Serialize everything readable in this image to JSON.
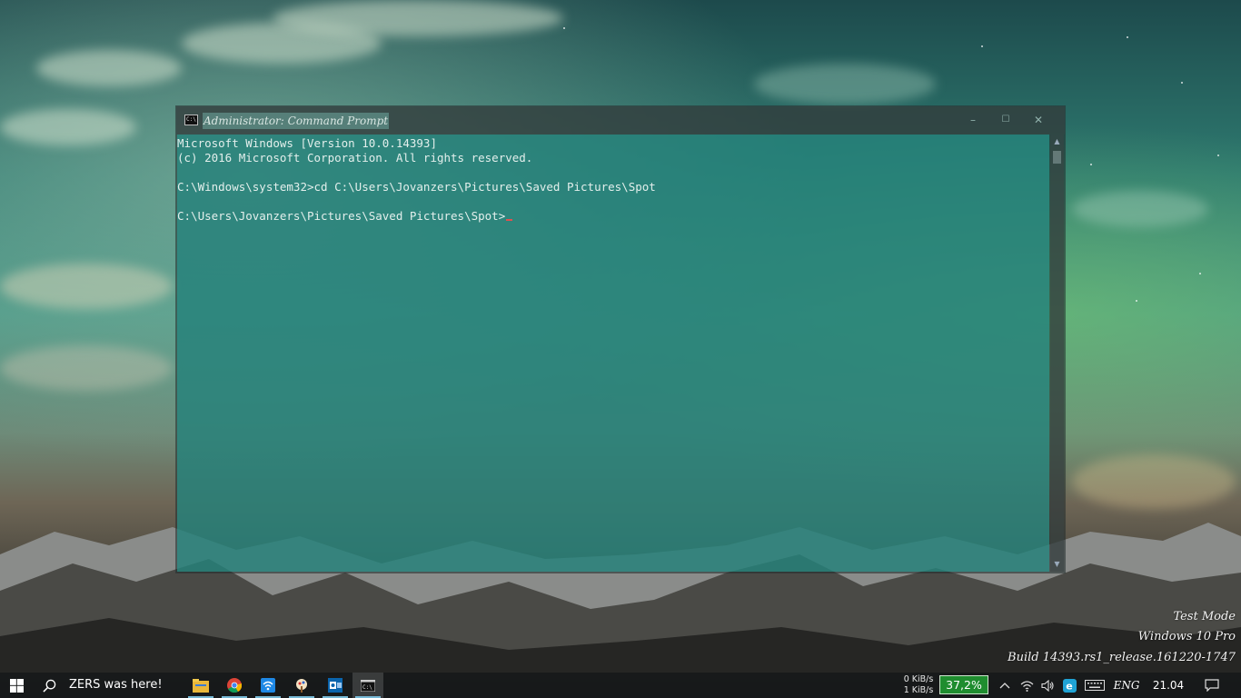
{
  "window": {
    "title": "Administrator: Command Prompt",
    "icon": "console-icon",
    "controls": {
      "minimize": "–",
      "maximize": "☐",
      "close": "✕"
    }
  },
  "console": {
    "lines": [
      "Microsoft Windows [Version 10.0.14393]",
      "(c) 2016 Microsoft Corporation. All rights reserved.",
      "",
      "C:\\Windows\\system32>cd C:\\Users\\Jovanzers\\Pictures\\Saved Pictures\\Spot",
      "",
      "C:\\Users\\Jovanzers\\Pictures\\Saved Pictures\\Spot>"
    ]
  },
  "watermark": {
    "line1": "Test Mode",
    "line2": "Windows 10 Pro",
    "line3": "Build 14393.rs1_release.161220-1747"
  },
  "taskbar": {
    "search_text": "ZERS was here!",
    "apps": [
      "file-explorer-icon",
      "chrome-icon",
      "network-app-icon",
      "paint-app-icon",
      "outlook-icon",
      "command-prompt-icon"
    ],
    "net_up": "0 KiB/s",
    "net_down": "1 KiB/s",
    "battery": "37,2%",
    "language": "ENG",
    "clock": "21.04",
    "accent": "#76b9d6",
    "battery_color": "#1f8d2f"
  }
}
